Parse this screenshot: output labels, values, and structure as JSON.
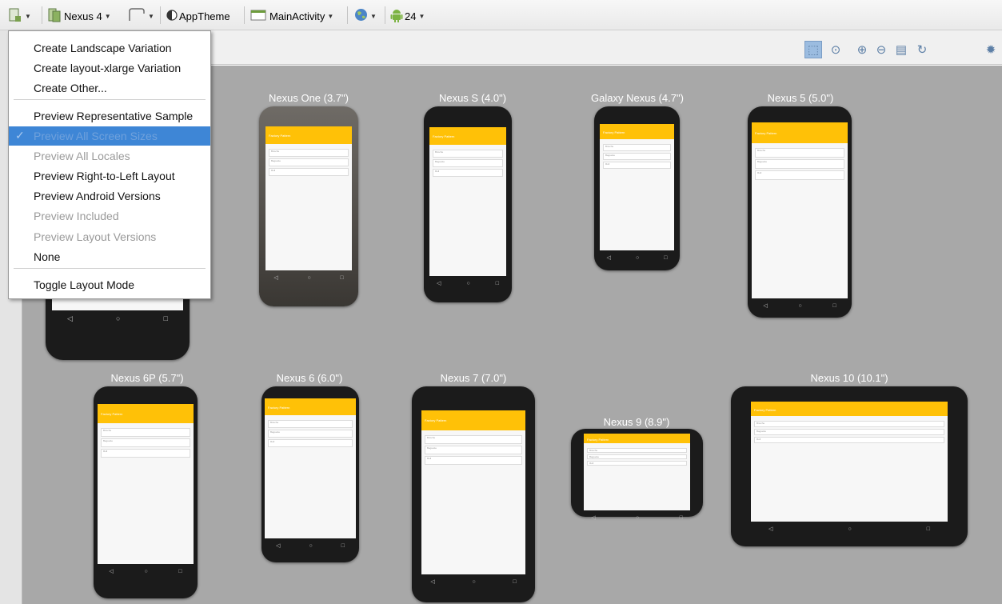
{
  "toolbar": {
    "device": "Nexus 4",
    "theme": "AppTheme",
    "activity": "MainActivity",
    "api_level": "24"
  },
  "menu": {
    "items": [
      {
        "label": "Create Landscape Variation",
        "state": "enabled"
      },
      {
        "label": "Create layout-xlarge Variation",
        "state": "enabled"
      },
      {
        "label": "Create Other...",
        "state": "enabled"
      },
      {
        "label": "Preview Representative Sample",
        "state": "enabled"
      },
      {
        "label": "Preview All Screen Sizes",
        "state": "selected"
      },
      {
        "label": "Preview All Locales",
        "state": "disabled"
      },
      {
        "label": "Preview Right-to-Left Layout",
        "state": "enabled"
      },
      {
        "label": "Preview Android Versions",
        "state": "enabled"
      },
      {
        "label": "Preview Included",
        "state": "disabled"
      },
      {
        "label": "Preview Layout Versions",
        "state": "disabled"
      },
      {
        "label": "None",
        "state": "enabled"
      },
      {
        "label": "Toggle Layout Mode",
        "state": "enabled"
      }
    ]
  },
  "devices": [
    {
      "id": "nexus-one",
      "label": "Nexus One (3.7\")"
    },
    {
      "id": "nexus-s",
      "label": "Nexus S (4.0\")"
    },
    {
      "id": "galaxy-nexus",
      "label": "Galaxy Nexus (4.7\")"
    },
    {
      "id": "nexus-5",
      "label": "Nexus 5 (5.0\")"
    },
    {
      "id": "nexus-6p",
      "label": "Nexus 6P (5.7\")"
    },
    {
      "id": "nexus-6",
      "label": "Nexus 6 (6.0\")"
    },
    {
      "id": "nexus-7",
      "label": "Nexus 7 (7.0\")"
    },
    {
      "id": "nexus-9",
      "label": "Nexus 9 (8.9\")"
    },
    {
      "id": "nexus-10",
      "label": "Nexus 10 (10.1\")"
    }
  ],
  "app": {
    "title": "Factory Pattern",
    "fields": [
      "Brioche",
      "Baguette",
      "Roll"
    ]
  },
  "colors": {
    "appbar": "#ffc107",
    "canvas": "#a8a8a8",
    "menu_selection": "#3e86d6"
  }
}
